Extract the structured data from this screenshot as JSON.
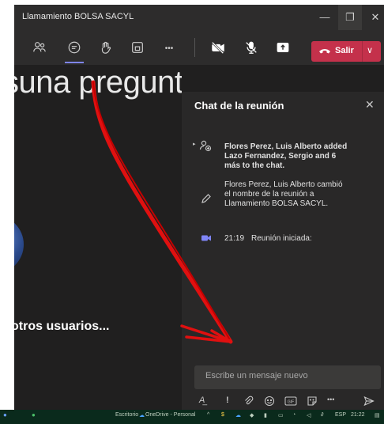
{
  "window": {
    "title": "Llamamiento BOLSA SACYL",
    "minimize": "—",
    "maximize": "❐",
    "close": "✕"
  },
  "toolbar": {
    "more": "•••",
    "leave_label": "Salir",
    "leave_chevron": "∨"
  },
  "stage": {
    "big_text": "suna pregunta",
    "others_label": "otros usuarios..."
  },
  "chat": {
    "title": "Chat de la reunión",
    "close": "✕",
    "messages": [
      {
        "icon": "people-add-icon",
        "text": "Flores Perez, Luis Alberto added Lazo Fernandez, Sergio and 6 más to the chat."
      },
      {
        "icon": "pencil-icon",
        "text": "Flores Perez, Luis Alberto cambió el nombre de la reunión a Llamamiento BOLSA SACYL."
      },
      {
        "icon": "video-icon",
        "time": "21:19",
        "text": "Reunión iniciada:"
      }
    ],
    "input_placeholder": "Escribe un mensaje nuevo",
    "format_icons": [
      "format-icon",
      "priority-icon",
      "attach-icon",
      "emoji-icon",
      "gif-icon",
      "sticker-icon",
      "more-icon",
      "send-icon"
    ]
  },
  "taskbar": {
    "desktop_label": "Escritorio",
    "onedrive_label": "OneDrive - Personal",
    "lang": "ESP",
    "time": "21:22"
  },
  "colors": {
    "leave": "#c4314b",
    "accent": "#7f85f5",
    "panel": "#292828",
    "arrow": "#e01010"
  }
}
